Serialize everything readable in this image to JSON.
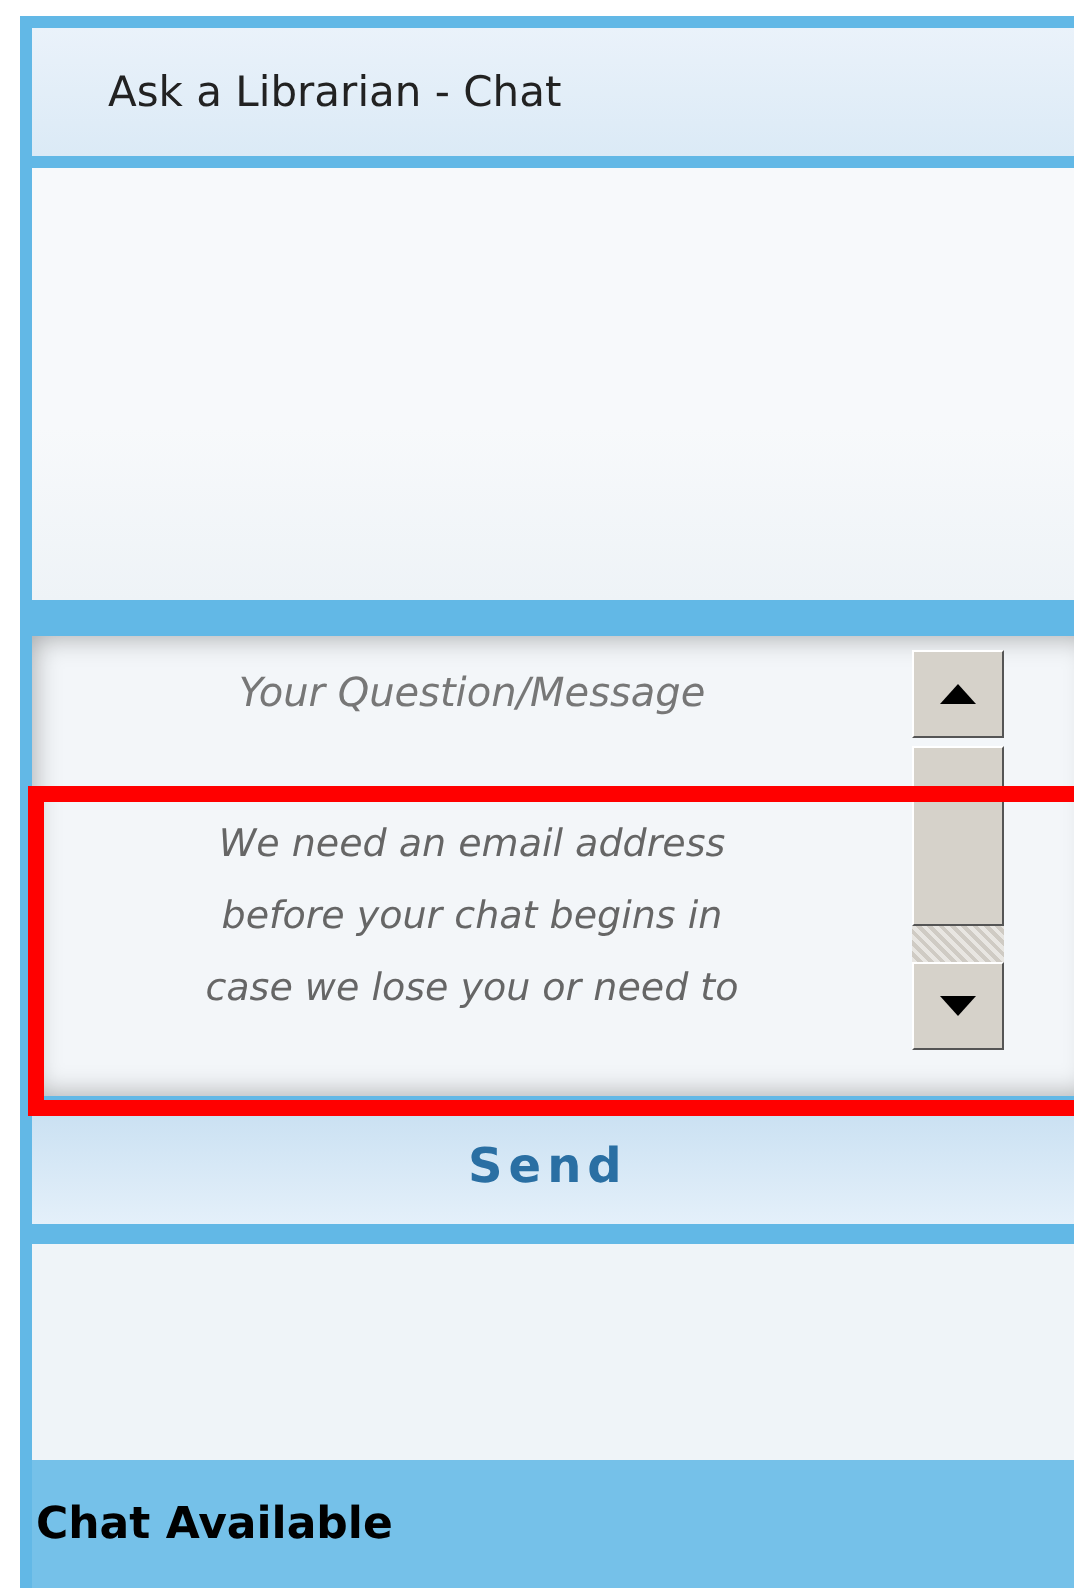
{
  "window": {
    "title": "Ask a Librarian - Chat"
  },
  "message_field": {
    "label": "Your Question/Message",
    "value_lines": [
      "We need an email address",
      "before your chat begins in",
      "case we lose you or need to"
    ]
  },
  "send_button": {
    "label": "Send"
  },
  "status_bar": {
    "text": "Chat Available"
  }
}
